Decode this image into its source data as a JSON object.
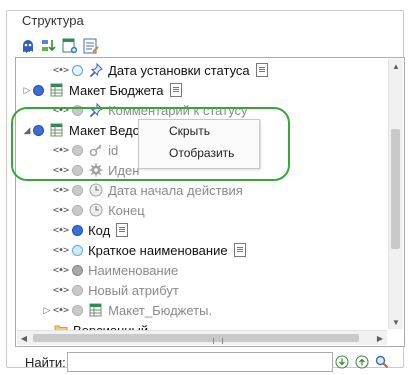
{
  "group": {
    "title": "Структура"
  },
  "toolbar": {
    "buttons": [
      "ghost-icon",
      "sort-tree-icon",
      "table-add-icon",
      "list-edit-icon"
    ]
  },
  "tree": {
    "rows": [
      {
        "label": "Дата установки статуса",
        "state": "empty",
        "icon": "pin-icon",
        "doc": true,
        "grey": false,
        "indent": 1,
        "expander": ""
      },
      {
        "label": "Макет Бюджета",
        "state": "blue",
        "icon": "table-icon",
        "doc": true,
        "grey": false,
        "indent": 0,
        "expander": "collapsed"
      },
      {
        "label": "Комментарий к статусу",
        "state": "lgray",
        "icon": "pin-icon",
        "doc": false,
        "grey": true,
        "indent": 1,
        "expander": ""
      },
      {
        "label": "Макет Ведомства",
        "state": "blue",
        "icon": "table-icon",
        "doc": true,
        "grey": false,
        "indent": 0,
        "expander": "expanded"
      },
      {
        "label": "id",
        "state": "lgray",
        "icon": "key-icon",
        "doc": false,
        "grey": true,
        "indent": 1,
        "expander": ""
      },
      {
        "label": "Иден",
        "state": "lgray",
        "icon": "gear-icon",
        "doc": false,
        "grey": true,
        "indent": 1,
        "expander": ""
      },
      {
        "label": "Дата начала действия",
        "state": "lgray",
        "icon": "clock-icon",
        "doc": false,
        "grey": true,
        "indent": 1,
        "expander": ""
      },
      {
        "label": "Конец",
        "state": "lgray",
        "icon": "clock-icon",
        "doc": false,
        "grey": true,
        "indent": 1,
        "expander": ""
      },
      {
        "label": "Код",
        "state": "blue",
        "icon": "",
        "doc": true,
        "grey": false,
        "indent": 1,
        "expander": ""
      },
      {
        "label": "Краткое наименование",
        "state": "light",
        "icon": "",
        "doc": true,
        "grey": false,
        "indent": 1,
        "expander": ""
      },
      {
        "label": "Наименование",
        "state": "gray",
        "icon": "",
        "doc": false,
        "grey": true,
        "indent": 1,
        "expander": ""
      },
      {
        "label": "Новый атрибут",
        "state": "lgray",
        "icon": "",
        "doc": false,
        "grey": true,
        "indent": 1,
        "expander": ""
      },
      {
        "label": "Макет_Бюджеты.",
        "state": "lgray",
        "icon": "table-icon",
        "doc": false,
        "grey": true,
        "indent": 1,
        "expander": "collapsed"
      },
      {
        "label": "Версионный",
        "state": "",
        "icon": "folder-icon",
        "doc": false,
        "grey": false,
        "indent": 1,
        "expander": ""
      }
    ]
  },
  "context_menu": {
    "items": [
      "Скрыть",
      "Отобразить"
    ]
  },
  "search": {
    "label": "Найти:",
    "value": "",
    "placeholder": ""
  },
  "colors": {
    "accent": "#3aa53a",
    "selected_blue": "#3b6fd6"
  }
}
